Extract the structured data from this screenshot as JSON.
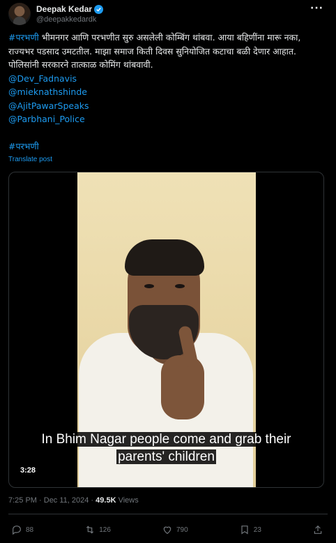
{
  "author": {
    "display_name": "Deepak Kedar",
    "handle": "@deepakkedardk"
  },
  "post": {
    "hashtag_start": "#परभणी",
    "body": " भीमनगर आणि परभणीत सुरु असलेली कोम्बिंग थांबवा. आया बहिणींना मारू नका, राज्यभर पडसाद उमटतील. माझा समाज किती दिवस सुनियोजित कटाचा बळी देणार आहात. पोलिसांनी सरकारने तात्काळ कोमिंग थांबवावी.",
    "mentions": [
      "@Dev_Fadnavis",
      "@mieknathshinde",
      "@AjitPawarSpeaks",
      "@Parbhani_Police"
    ],
    "hashtag_end": "#परभणी",
    "translate_label": "Translate post"
  },
  "media": {
    "caption_line1": "In Bhim Nagar people come and grab their",
    "caption_line2": "parents' children",
    "duration": "3:28"
  },
  "meta": {
    "time": "7:25 PM",
    "separator": " · ",
    "date": "Dec 11, 2024",
    "separator2": " · ",
    "views_count": "49.5K",
    "views_label": " Views"
  },
  "actions": {
    "replies": "88",
    "reposts": "126",
    "likes": "790",
    "bookmarks": "23"
  },
  "icons": {
    "more": "more-icon",
    "verified": "verified-badge-icon",
    "reply": "reply-icon",
    "repost": "repost-icon",
    "like": "heart-icon",
    "bookmark": "bookmark-icon",
    "share": "share-icon"
  },
  "colors": {
    "background": "#000000",
    "accent": "#1d9bf0",
    "text_primary": "#e7e9ea",
    "text_secondary": "#71767b"
  }
}
